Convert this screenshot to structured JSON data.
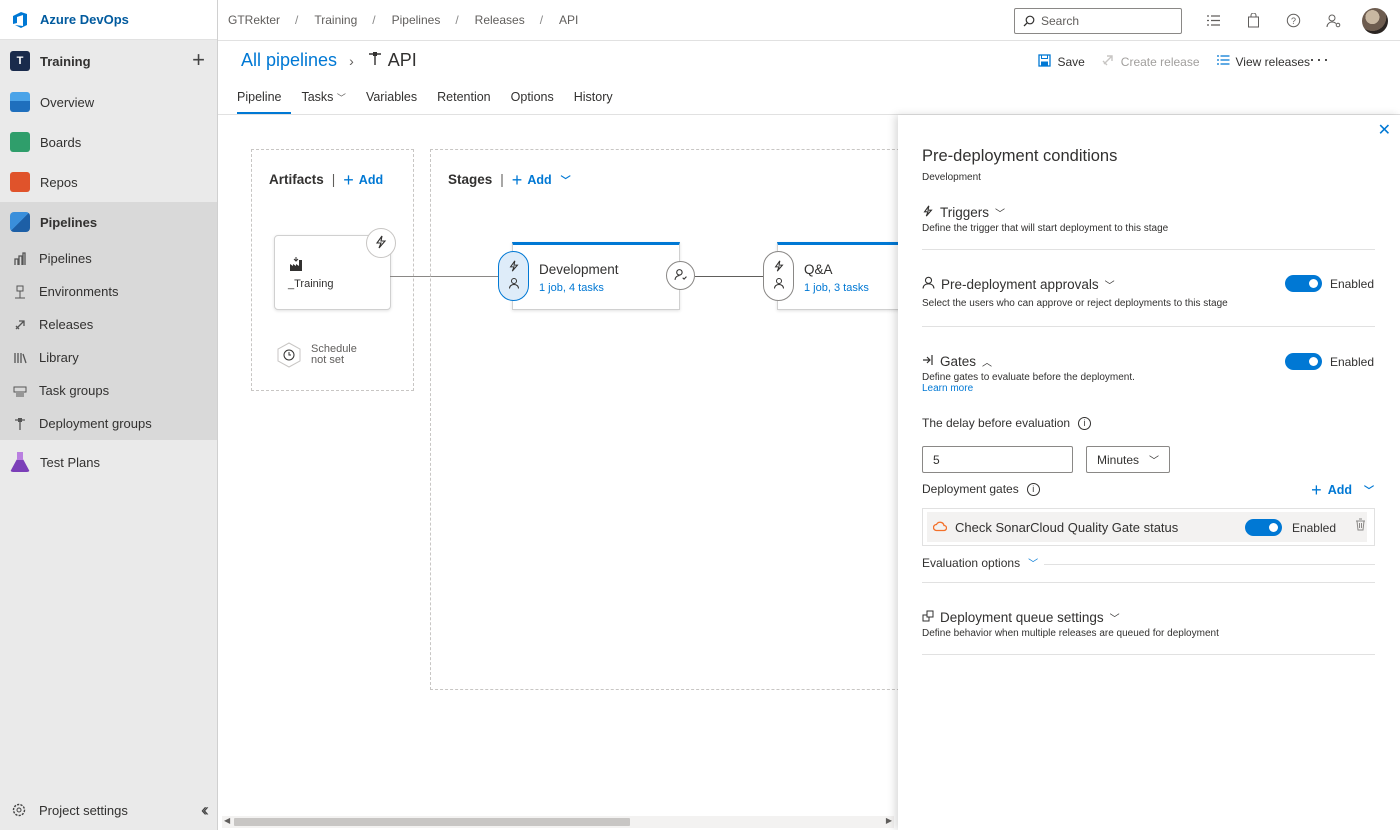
{
  "brand": {
    "name": "Azure DevOps"
  },
  "project": {
    "initial": "T",
    "name": "Training"
  },
  "nav": {
    "overview": "Overview",
    "boards": "Boards",
    "repos": "Repos",
    "pipelines": "Pipelines",
    "sub": [
      "Pipelines",
      "Environments",
      "Releases",
      "Library",
      "Task groups",
      "Deployment groups"
    ],
    "test_plans": "Test Plans",
    "project_settings": "Project settings"
  },
  "breadcrumb": [
    "GTRekter",
    "Training",
    "Pipelines",
    "Releases",
    "API"
  ],
  "search": {
    "placeholder": "Search"
  },
  "header": {
    "all_pipelines": "All pipelines",
    "pipeline_name": "API",
    "save": "Save",
    "create_release": "Create release",
    "view_releases": "View releases",
    "more": "···"
  },
  "tabs": [
    "Pipeline",
    "Tasks",
    "Variables",
    "Retention",
    "Options",
    "History"
  ],
  "canvas": {
    "artifacts_label": "Artifacts",
    "add_label": "Add",
    "artifact_name": "_Training",
    "schedule_line1": "Schedule",
    "schedule_line2": "not set",
    "stages_label": "Stages",
    "stages": [
      {
        "name": "Development",
        "meta": "1 job, 4 tasks"
      },
      {
        "name": "Q&A",
        "meta": "1 job, 3 tasks"
      }
    ]
  },
  "panel": {
    "title": "Pre-deployment conditions",
    "subtitle": "Development",
    "triggers": {
      "title": "Triggers",
      "desc": "Define the trigger that will start deployment to this stage"
    },
    "approvals": {
      "title": "Pre-deployment approvals",
      "desc": "Select the users who can approve or reject deployments to this stage",
      "state": "Enabled"
    },
    "gates": {
      "title": "Gates",
      "desc": "Define gates to evaluate before the deployment.",
      "learn_more": "Learn more",
      "state": "Enabled",
      "delay_label": "The delay before evaluation",
      "delay_value": "5",
      "delay_unit": "Minutes",
      "deployment_gates_label": "Deployment gates",
      "add_label": "Add",
      "gate_name": "Check SonarCloud Quality Gate status",
      "gate_state": "Enabled",
      "evaluation_options": "Evaluation options"
    },
    "queue": {
      "title": "Deployment queue settings",
      "desc": "Define behavior when multiple releases are queued for deployment"
    }
  },
  "colors": {
    "accent": "#0078d4",
    "sidebar": "#eaeaea"
  }
}
